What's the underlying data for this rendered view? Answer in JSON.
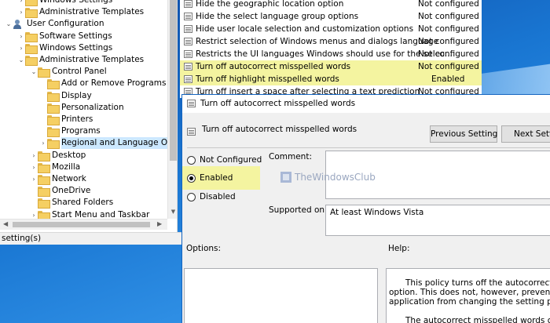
{
  "tree": {
    "items": [
      {
        "label": "Windows Settings",
        "chevron": "›",
        "icon": "folder-icon",
        "indent": 1
      },
      {
        "label": "Administrative Templates",
        "chevron": "›",
        "icon": "folder-icon",
        "indent": 1
      },
      {
        "label": "User Configuration",
        "chevron": "⌄",
        "icon": "user-config-icon",
        "indent": 0
      },
      {
        "label": "Software Settings",
        "chevron": "›",
        "icon": "folder-icon",
        "indent": 1
      },
      {
        "label": "Windows Settings",
        "chevron": "›",
        "icon": "folder-icon",
        "indent": 1
      },
      {
        "label": "Administrative Templates",
        "chevron": "⌄",
        "icon": "folder-icon",
        "indent": 1
      },
      {
        "label": "Control Panel",
        "chevron": "⌄",
        "icon": "folder-icon",
        "indent": 2
      },
      {
        "label": "Add or Remove Programs",
        "chevron": "",
        "icon": "folder-icon",
        "indent": 3
      },
      {
        "label": "Display",
        "chevron": "",
        "icon": "folder-icon",
        "indent": 3
      },
      {
        "label": "Personalization",
        "chevron": "",
        "icon": "folder-icon",
        "indent": 3
      },
      {
        "label": "Printers",
        "chevron": "",
        "icon": "folder-icon",
        "indent": 3
      },
      {
        "label": "Programs",
        "chevron": "",
        "icon": "folder-icon",
        "indent": 3
      },
      {
        "label": "Regional and Language Options",
        "chevron": "›",
        "icon": "folder-icon",
        "indent": 3,
        "selected": true
      },
      {
        "label": "Desktop",
        "chevron": "›",
        "icon": "folder-icon",
        "indent": 2
      },
      {
        "label": "Mozilla",
        "chevron": "›",
        "icon": "folder-icon",
        "indent": 2
      },
      {
        "label": "Network",
        "chevron": "›",
        "icon": "folder-icon",
        "indent": 2
      },
      {
        "label": "OneDrive",
        "chevron": "",
        "icon": "folder-icon",
        "indent": 2
      },
      {
        "label": "Shared Folders",
        "chevron": "",
        "icon": "folder-icon",
        "indent": 2
      },
      {
        "label": "Start Menu and Taskbar",
        "chevron": "›",
        "icon": "folder-icon",
        "indent": 2
      }
    ]
  },
  "status_bar": {
    "text": "setting(s)"
  },
  "settings_list": {
    "rows": [
      {
        "name": "Hide the geographic location option",
        "state": "Not configured",
        "highlight": false
      },
      {
        "name": "Hide the select language group options",
        "state": "Not configured",
        "highlight": false
      },
      {
        "name": "Hide user locale selection and customization options",
        "state": "Not configured",
        "highlight": false
      },
      {
        "name": "Restrict selection of Windows menus and dialogs language",
        "state": "Not configured",
        "highlight": false
      },
      {
        "name": "Restricts the UI languages Windows should use for the selec...",
        "state": "Not configured",
        "highlight": false
      },
      {
        "name": "Turn off autocorrect misspelled words",
        "state": "Not configured",
        "highlight": true
      },
      {
        "name": "Turn off highlight misspelled words",
        "state": "Enabled",
        "highlight": true
      },
      {
        "name": "Turn off insert a space after selecting a text prediction",
        "state": "Not configured",
        "highlight": false
      }
    ]
  },
  "dialog": {
    "window_title": "Turn off autocorrect misspelled words",
    "header_title": "Turn off autocorrect misspelled words",
    "previous_button": "Previous Setting",
    "next_button": "Next Setting",
    "radios": {
      "not_configured": "Not Configured",
      "enabled": "Enabled",
      "disabled": "Disabled",
      "selected": "enabled"
    },
    "comment_label": "Comment:",
    "supported_label": "Supported on:",
    "supported_value": "At least Windows Vista",
    "options_label": "Options:",
    "help_label": "Help:",
    "help_lines": [
      "This policy turns off the autocorrect missp",
      "option. This does not, however, prevent the us",
      "application from changing the setting program",
      "",
      "The autocorrect misspelled words option"
    ],
    "watermark": "TheWindowsClub"
  },
  "colors": {
    "highlight": "#f4f4a0",
    "desktop_blue": "#1976d2",
    "dialog_bg": "#f0f0f0"
  }
}
